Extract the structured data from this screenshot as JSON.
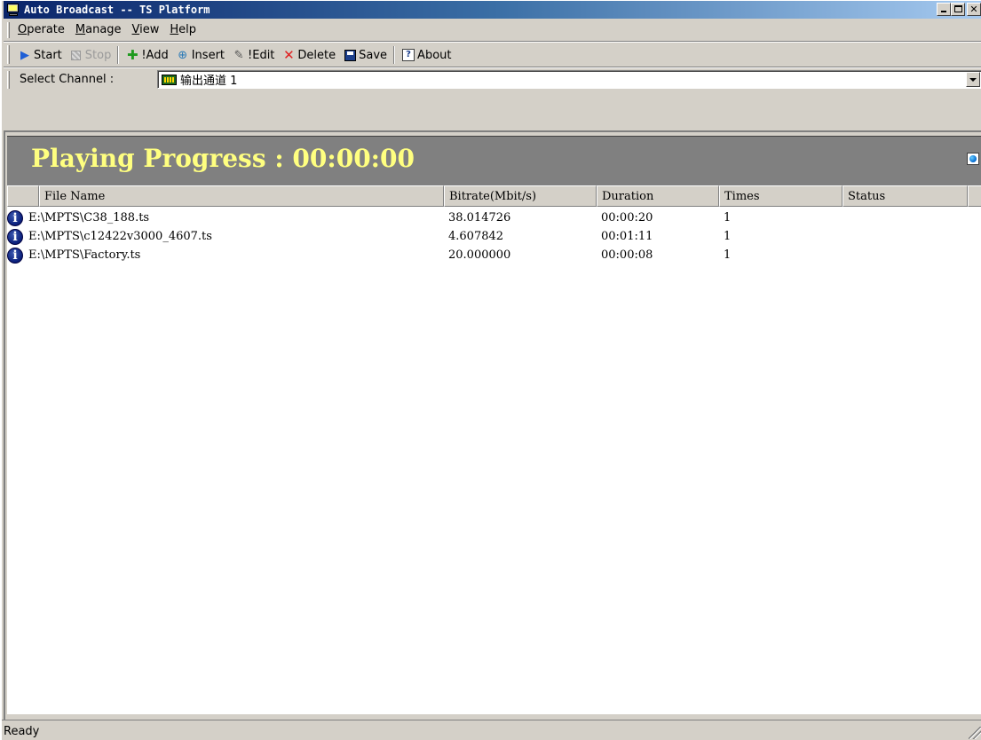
{
  "window": {
    "title": "Auto Broadcast -- TS Platform"
  },
  "menu": {
    "items": [
      {
        "key": "O",
        "rest": "perate"
      },
      {
        "key": "M",
        "rest": "anage"
      },
      {
        "key": "V",
        "rest": "iew"
      },
      {
        "key": "H",
        "rest": "elp"
      }
    ]
  },
  "toolbar": {
    "start": "Start",
    "stop": "Stop",
    "add": "!Add",
    "insert": "Insert",
    "edit": "!Edit",
    "delete": "Delete",
    "save": "Save",
    "about": "About"
  },
  "channel": {
    "label": "Select Channel :",
    "value": "输出通道 1"
  },
  "progress": {
    "text": "Playing Progress : 00:00:00"
  },
  "list": {
    "columns": [
      "File Name",
      "Bitrate(Mbit/s)",
      "Duration",
      "Times",
      "Status"
    ],
    "rows": [
      {
        "file": "E:\\MPTS\\C38_188.ts",
        "bitrate": "38.014726",
        "duration": "00:00:20",
        "times": "1",
        "status": ""
      },
      {
        "file": "E:\\MPTS\\c12422v3000_4607.ts",
        "bitrate": "4.607842",
        "duration": "00:01:11",
        "times": "1",
        "status": ""
      },
      {
        "file": "E:\\MPTS\\Factory.ts",
        "bitrate": "20.000000",
        "duration": "00:00:08",
        "times": "1",
        "status": ""
      }
    ]
  },
  "status": {
    "text": "Ready"
  },
  "colors": {
    "progress_text": "#ffff80",
    "progress_bg": "#808080",
    "info_icon": "#0a1f7a"
  }
}
